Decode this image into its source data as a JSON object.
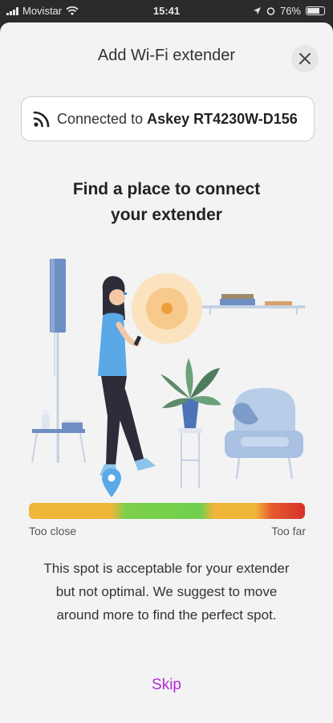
{
  "status_bar": {
    "carrier": "Movistar",
    "time": "15:41",
    "battery": "76%"
  },
  "dialog": {
    "title": "Add Wi-Fi extender"
  },
  "connection": {
    "prefix": "Connected to",
    "device": "Askey RT4230W-D156"
  },
  "instructions": {
    "heading_line1": "Find a place to connect",
    "heading_line2": "your extender"
  },
  "signal_gauge": {
    "left_label": "Too close",
    "right_label": "Too far",
    "position_fraction": 0.3,
    "colors": {
      "close": "#f0b63a",
      "good": "#6fd04d",
      "far": "#d6322a"
    }
  },
  "result": {
    "message": "This spot is acceptable for your extender but not optimal. We suggest to move around more to find the perfect spot."
  },
  "actions": {
    "skip_label": "Skip",
    "accent_color": "#b42ad4"
  },
  "icons": {
    "close": "close-icon",
    "wifi": "wifi-signal-icon",
    "pin": "location-pin-icon"
  }
}
